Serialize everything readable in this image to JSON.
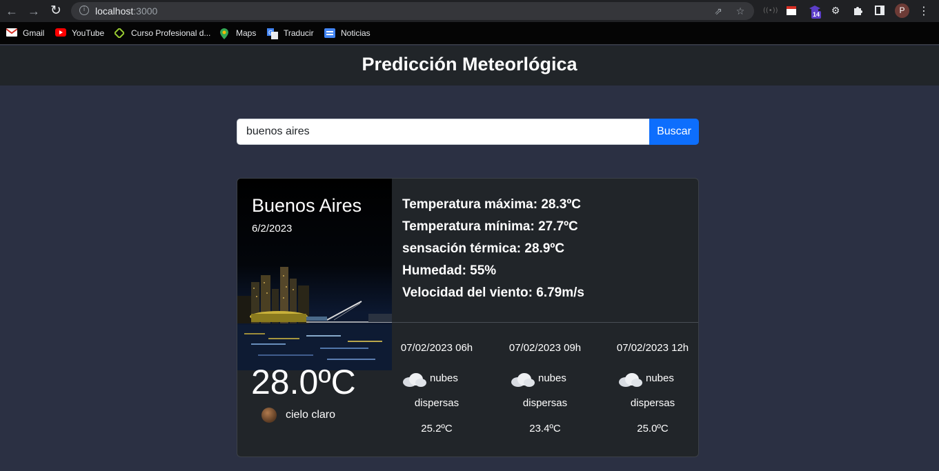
{
  "browser": {
    "url_host": "localhost",
    "url_port": ":3000",
    "bookmarks": [
      {
        "label": "Gmail",
        "icon": "gmail-icon"
      },
      {
        "label": "YouTube",
        "icon": "youtube-icon"
      },
      {
        "label": "Curso Profesional d...",
        "icon": "course-icon"
      },
      {
        "label": "Maps",
        "icon": "maps-icon"
      },
      {
        "label": "Traducir",
        "icon": "translate-icon"
      },
      {
        "label": "Noticias",
        "icon": "news-icon"
      }
    ],
    "extension_badge": "14",
    "profile_initial": "P"
  },
  "app": {
    "title": "Predicción Meteorlógica",
    "search": {
      "value": "buenos aires",
      "button": "Buscar"
    },
    "current": {
      "city": "Buenos Aires",
      "date": "6/2/2023",
      "temperature": "28.0ºC",
      "description": "cielo claro",
      "icon": "clear-sky-icon"
    },
    "stats": [
      "Temperatura máxima: 28.3ºC",
      "Temperatura mínima: 27.7ºC",
      "sensación térmica: 28.9ºC",
      "Humedad: 55%",
      "Velocidad del viento: 6.79m/s"
    ],
    "forecast": [
      {
        "time": "07/02/2023 06h",
        "desc1": "nubes",
        "desc2": "dispersas",
        "temp": "25.2ºC",
        "icon": "cloud-icon"
      },
      {
        "time": "07/02/2023 09h",
        "desc1": "nubes",
        "desc2": "dispersas",
        "temp": "23.4ºC",
        "icon": "cloud-icon"
      },
      {
        "time": "07/02/2023 12h",
        "desc1": "nubes",
        "desc2": "dispersas",
        "temp": "25.0ºC",
        "icon": "cloud-icon"
      }
    ]
  }
}
